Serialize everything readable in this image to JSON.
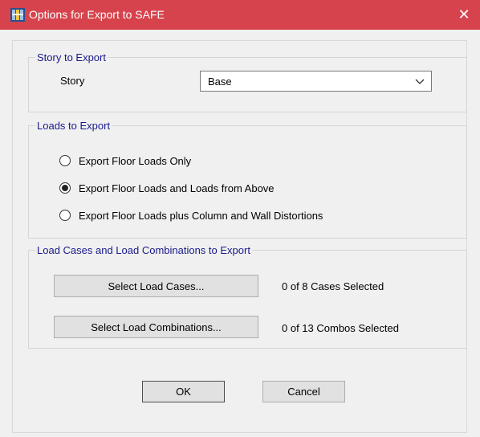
{
  "window": {
    "title": "Options for Export to SAFE",
    "icon": "safe-app-icon",
    "close_icon": "close-icon",
    "title_bar_color": "#d6434c"
  },
  "story_group": {
    "legend": "Story to Export",
    "story_label": "Story",
    "story_value": "Base"
  },
  "loads_group": {
    "legend": "Loads to Export",
    "options": [
      {
        "label": "Export Floor Loads Only",
        "selected": false
      },
      {
        "label": "Export Floor Loads and Loads from Above",
        "selected": true
      },
      {
        "label": "Export Floor Loads plus Column and Wall Distortions",
        "selected": false
      }
    ]
  },
  "cases_group": {
    "legend": "Load Cases and Load Combinations to Export",
    "select_cases_label": "Select Load Cases...",
    "cases_status": "0 of 8 Cases Selected",
    "select_combos_label": "Select Load Combinations...",
    "combos_status": "0 of 13 Combos Selected"
  },
  "footer": {
    "ok_label": "OK",
    "cancel_label": "Cancel"
  },
  "colors": {
    "group_legend": "#1a1a8c",
    "dialog_bg": "#f0f0f0"
  }
}
